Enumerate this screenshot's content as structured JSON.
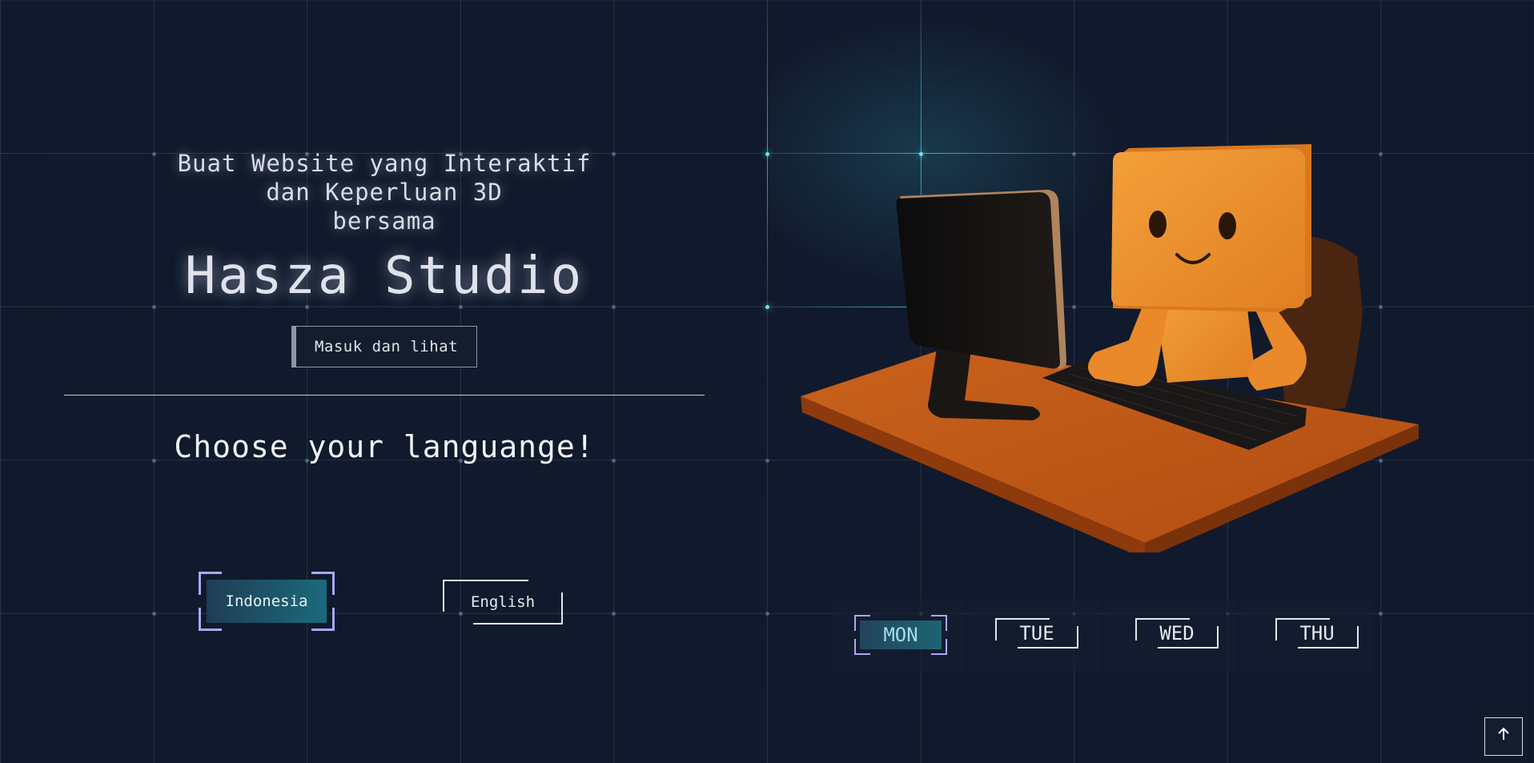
{
  "hero": {
    "tagline_line1": "Buat Website yang Interaktif",
    "tagline_line2": "dan Keperluan 3D",
    "tagline_line3": "bersama",
    "studio_name": "Hasza Studio",
    "cta_label": "Masuk dan lihat"
  },
  "language": {
    "heading": "Choose your languange!",
    "options": [
      "Indonesia",
      "English"
    ],
    "selected": "Indonesia"
  },
  "days": {
    "items": [
      "MON",
      "TUE",
      "WED",
      "THU"
    ],
    "selected": "MON"
  },
  "scroll_top": {
    "icon": "arrow-up-icon",
    "glyph": "🡑"
  },
  "colors": {
    "background": "#111a2c",
    "accent_cyan": "#4fd6ea",
    "corner_purple": "#a9a8f2",
    "robot_orange": "#e8902a"
  }
}
